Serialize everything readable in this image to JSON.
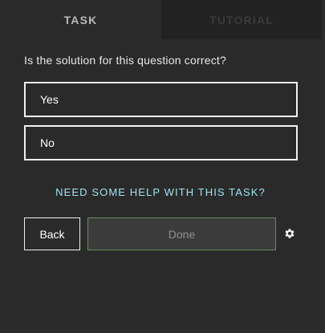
{
  "tabs": {
    "task": "TASK",
    "tutorial": "TUTORIAL"
  },
  "question": "Is the solution for this question correct?",
  "choices": [
    "Yes",
    "No"
  ],
  "help_link": "NEED SOME HELP WITH THIS TASK?",
  "buttons": {
    "back": "Back",
    "done": "Done"
  },
  "icons": {
    "settings": "gear-icon"
  },
  "colors": {
    "background": "#2a2a2a",
    "tab_inactive_bg": "#222222",
    "help_link": "#9fe3ee",
    "done_border": "#6c8a5a"
  }
}
